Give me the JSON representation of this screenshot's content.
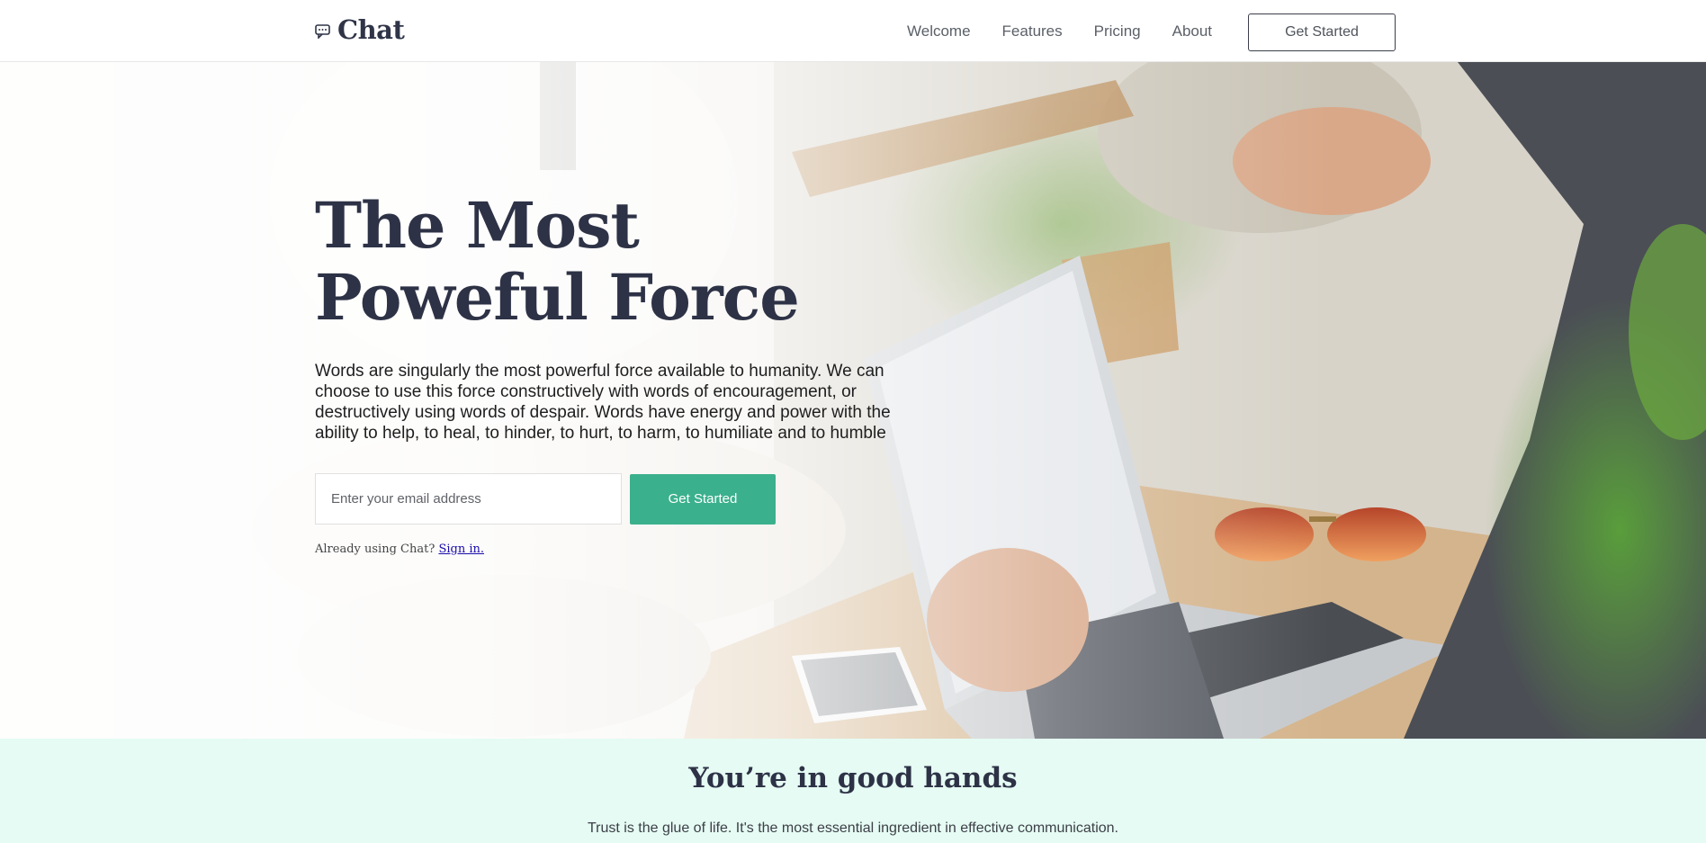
{
  "navbar": {
    "brand_name": "Chat",
    "brand_icon": "chat-bubble-icon",
    "links": [
      "Welcome",
      "Features",
      "Pricing",
      "About"
    ],
    "cta_label": "Get Started"
  },
  "hero": {
    "title_line1": "The Most",
    "title_line2": "Poweful Force",
    "text": "Words are singularly the most powerful force available to humanity. We can choose to use this force constructively with words of encouragement, or destructively using words of despair. Words have energy and power with the ability to help, to heal, to hinder, to hurt, to harm, to humiliate and to humble",
    "email_placeholder": "Enter your email address",
    "signup_label": "Get Started",
    "signin_prompt": "Already using Chat?",
    "signin_link": "Sign in."
  },
  "trust": {
    "title": "You’re in good hands",
    "text": "Trust is the glue of life. It's the most essential ingredient in effective communication."
  },
  "colors": {
    "accent": "#3bb08c",
    "heading": "#2d3246",
    "trust_background": "#e5fbf3"
  }
}
